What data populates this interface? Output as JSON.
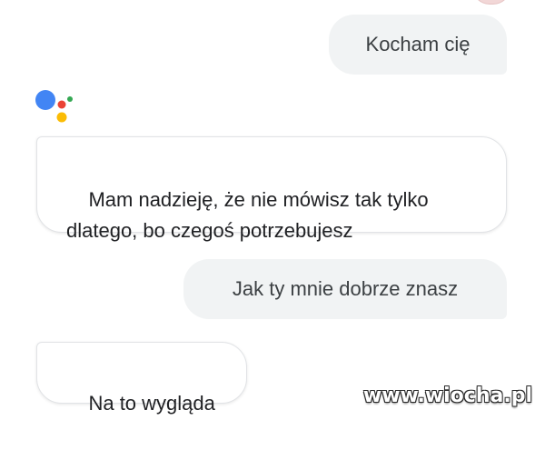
{
  "conversation": {
    "messages": [
      {
        "role": "user",
        "text": "Kocham cię"
      },
      {
        "role": "assistant",
        "text": "Mam nadzieję, że nie mówisz tak tylko\ndlatego, bo czegoś potrzebujesz"
      },
      {
        "role": "user",
        "text": "Jak ty mnie dobrze znasz"
      },
      {
        "role": "assistant",
        "text": "Na to wygląda"
      }
    ]
  },
  "watermark": {
    "text": "www.wiocha.pl"
  },
  "icons": {
    "assistant_logo": "google-assistant-icon"
  },
  "colors": {
    "user_bubble": "#f1f3f4",
    "assistant_bubble": "#ffffff",
    "logo_blue": "#4285f4",
    "logo_red": "#ea4335",
    "logo_yellow": "#fbbc05",
    "logo_green": "#34a853"
  }
}
